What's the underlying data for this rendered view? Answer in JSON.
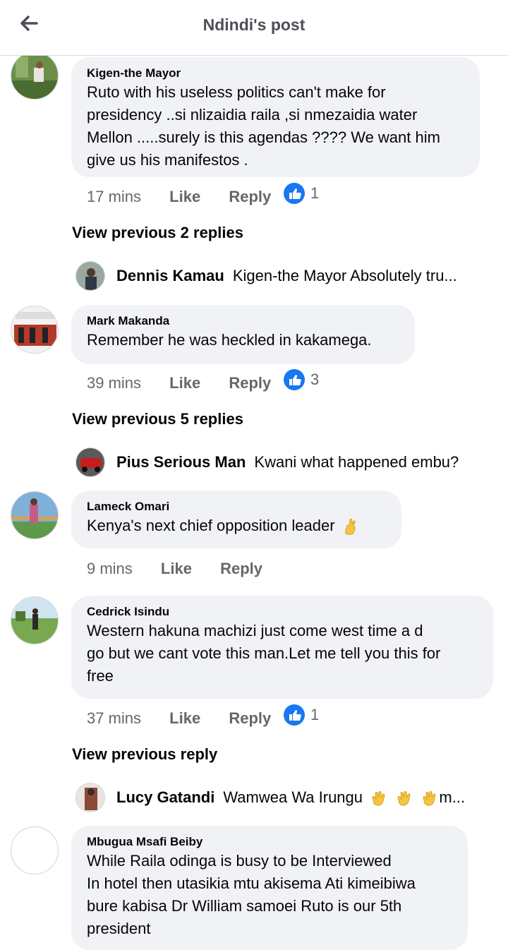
{
  "header": {
    "title": "Ndindi's post"
  },
  "comments": [
    {
      "author": "Kigen-the Mayor",
      "lines": [
        "Ruto with his useless politics can't make for",
        "presidency ..si nlizaidia raila ,si nmezaidia water",
        "Mellon .....surely is this agendas ???? We want him",
        "give us his manifestos ."
      ],
      "time": "17 mins",
      "like": "Like",
      "reply": "Reply",
      "reactions": "1",
      "view_previous": "View previous 2 replies",
      "reply_preview": {
        "name": "Dennis Kamau",
        "text": "Kigen-the Mayor Absolutely tru..."
      }
    },
    {
      "author": "Mark Makanda",
      "lines": [
        "Remember he was heckled in kakamega."
      ],
      "time": "39 mins",
      "like": "Like",
      "reply": "Reply",
      "reactions": "3",
      "view_previous": "View previous 5 replies",
      "reply_preview": {
        "name": "Pius Serious Man",
        "text": "Kwani what happened embu?"
      }
    },
    {
      "author": "Lameck Omari",
      "lines": [
        "Kenya's next chief opposition leader"
      ],
      "emoji": "crossed-fingers-emoji",
      "time": "9 mins",
      "like": "Like",
      "reply": "Reply"
    },
    {
      "author": "Cedrick Isindu",
      "lines": [
        "Western hakuna machizi  just come west time a d",
        "go but we cant vote this man.Let me tell you this for",
        "free"
      ],
      "time": "37 mins",
      "like": "Like",
      "reply": "Reply",
      "reactions": "1",
      "view_previous": "View previous reply",
      "reply_preview": {
        "name": "Lucy Gatandi",
        "text": "Wamwea Wa Irungu",
        "text_after_emoji": "m..."
      }
    },
    {
      "author": "Mbugua Msafi Beiby",
      "lines": [
        "While Raila odinga is busy to be Interviewed",
        "In hotel then utasikia mtu akisema Ati kimeibiwa",
        "bure kabisa Dr William samoei Ruto is our 5th",
        "president"
      ]
    }
  ],
  "colors": {
    "accent": "#1877f2",
    "bubble": "#f0f2f5",
    "meta": "#65676b"
  }
}
